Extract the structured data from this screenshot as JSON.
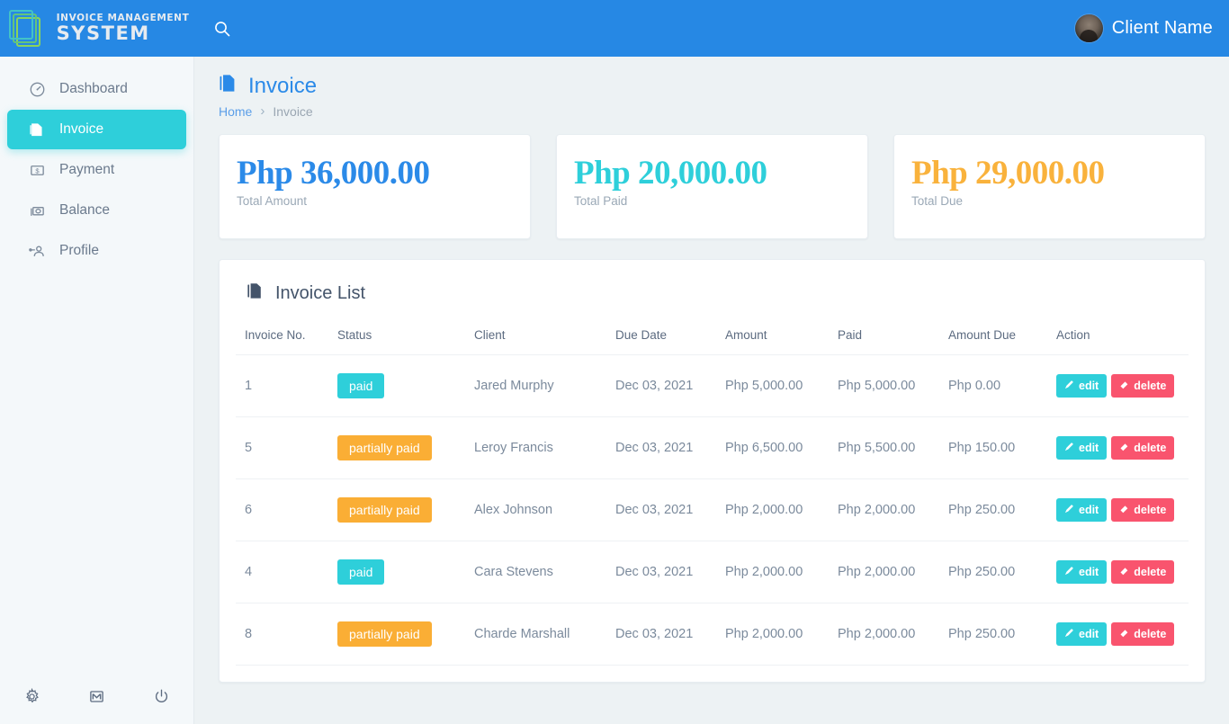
{
  "brand": {
    "line1": "INVOICE MANAGEMENT",
    "line2": "SYSTEM",
    "logo_icon": "stacked-documents-icon"
  },
  "topbar": {
    "search_icon": "search-icon",
    "user_name": "Client Name",
    "avatar_icon": "user-avatar"
  },
  "sidebar": {
    "items": [
      {
        "label": "Dashboard",
        "icon": "dashboard-gauge-icon",
        "active": false
      },
      {
        "label": "Invoice",
        "icon": "document-icon",
        "active": true
      },
      {
        "label": "Payment",
        "icon": "money-bill-icon",
        "active": false
      },
      {
        "label": "Balance",
        "icon": "cash-stack-icon",
        "active": false
      },
      {
        "label": "Profile",
        "icon": "user-profile-icon",
        "active": false
      }
    ],
    "footer_icons": [
      "gear-icon",
      "mail-icon",
      "power-icon"
    ]
  },
  "page": {
    "title": "Invoice",
    "title_icon": "document-icon",
    "breadcrumb": {
      "home": "Home",
      "separator": "›",
      "current": "Invoice"
    }
  },
  "summary_cards": [
    {
      "value": "Php 36,000.00",
      "label": "Total Amount",
      "color": "#2b8ae8"
    },
    {
      "value": "Php 20,000.00",
      "label": "Total Paid",
      "color": "#2ecfda"
    },
    {
      "value": "Php 29,000.00",
      "label": "Total Due",
      "color": "#f9b23c"
    }
  ],
  "invoice_list": {
    "title": "Invoice List",
    "title_icon": "document-icon",
    "columns": [
      "Invoice No.",
      "Status",
      "Client",
      "Due Date",
      "Amount",
      "Paid",
      "Amount Due",
      "Action"
    ],
    "rows": [
      {
        "invoice_no": "1",
        "status": "paid",
        "status_type": "paid",
        "client": "Jared Murphy",
        "due_date": "Dec 03, 2021",
        "amount": "Php 5,000.00",
        "paid": "Php 5,000.00",
        "amount_due": "Php 0.00",
        "edit_label": "edit",
        "delete_label": "delete"
      },
      {
        "invoice_no": "5",
        "status": "partially paid",
        "status_type": "partial",
        "client": "Leroy Francis",
        "due_date": "Dec 03, 2021",
        "amount": "Php 6,500.00",
        "paid": "Php 5,500.00",
        "amount_due": "Php 150.00",
        "edit_label": "edit",
        "delete_label": "delete"
      },
      {
        "invoice_no": "6",
        "status": "partially paid",
        "status_type": "partial",
        "client": "Alex Johnson",
        "due_date": "Dec 03, 2021",
        "amount": "Php 2,000.00",
        "paid": "Php 2,000.00",
        "amount_due": "Php 250.00",
        "edit_label": "edit",
        "delete_label": "delete"
      },
      {
        "invoice_no": "4",
        "status": "paid",
        "status_type": "paid",
        "client": "Cara Stevens",
        "due_date": "Dec 03, 2021",
        "amount": "Php 2,000.00",
        "paid": "Php 2,000.00",
        "amount_due": "Php 250.00",
        "edit_label": "edit",
        "delete_label": "delete"
      },
      {
        "invoice_no": "8",
        "status": "partially paid",
        "status_type": "partial",
        "client": "Charde Marshall",
        "due_date": "Dec 03, 2021",
        "amount": "Php 2,000.00",
        "paid": "Php 2,000.00",
        "amount_due": "Php 250.00",
        "edit_label": "edit",
        "delete_label": "delete"
      }
    ],
    "edit_icon": "pencil-icon",
    "delete_icon": "eraser-icon"
  },
  "colors": {
    "topbar_blue": "#2688e4",
    "accent_cyan": "#2ecfda",
    "warning_orange": "#faae35",
    "danger_red": "#f9546e",
    "page_bg": "#edf2f4"
  }
}
